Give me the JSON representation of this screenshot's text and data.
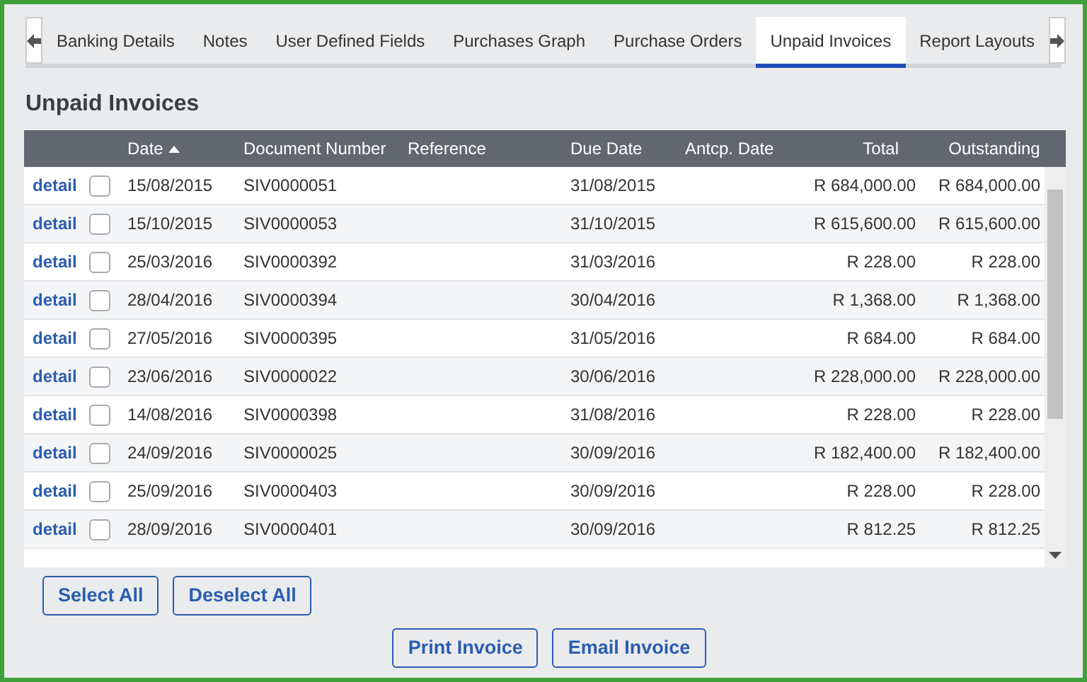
{
  "tabs": [
    {
      "label": "Banking Details",
      "selected": false
    },
    {
      "label": "Notes",
      "selected": false
    },
    {
      "label": "User Defined Fields",
      "selected": false
    },
    {
      "label": "Purchases Graph",
      "selected": false
    },
    {
      "label": "Purchase Orders",
      "selected": false
    },
    {
      "label": "Unpaid Invoices",
      "selected": true
    },
    {
      "label": "Report Layouts",
      "selected": false
    }
  ],
  "heading": "Unpaid Invoices",
  "table": {
    "columns": [
      {
        "label": "Date",
        "sorted": true
      },
      {
        "label": "Document Number",
        "sorted": false
      },
      {
        "label": "Reference",
        "sorted": false
      },
      {
        "label": "Due Date",
        "sorted": false
      },
      {
        "label": "Antcp. Date",
        "sorted": false
      },
      {
        "label": "Total",
        "sorted": false
      },
      {
        "label": "Outstanding",
        "sorted": false
      }
    ],
    "rows": [
      {
        "link": "detail",
        "checked": false,
        "date": "15/08/2015",
        "document_number": "SIV0000051",
        "due_date": "31/08/2015",
        "total": "R 684,000.00",
        "outstanding": "R 684,000.00"
      },
      {
        "link": "detail",
        "checked": false,
        "date": "15/10/2015",
        "document_number": "SIV0000053",
        "due_date": "31/10/2015",
        "total": "R 615,600.00",
        "outstanding": "R 615,600.00"
      },
      {
        "link": "detail",
        "checked": false,
        "date": "25/03/2016",
        "document_number": "SIV0000392",
        "due_date": "31/03/2016",
        "total": "R 228.00",
        "outstanding": "R 228.00"
      },
      {
        "link": "detail",
        "checked": false,
        "date": "28/04/2016",
        "document_number": "SIV0000394",
        "due_date": "30/04/2016",
        "total": "R 1,368.00",
        "outstanding": "R 1,368.00"
      },
      {
        "link": "detail",
        "checked": false,
        "date": "27/05/2016",
        "document_number": "SIV0000395",
        "due_date": "31/05/2016",
        "total": "R 684.00",
        "outstanding": "R 684.00"
      },
      {
        "link": "detail",
        "checked": false,
        "date": "23/06/2016",
        "document_number": "SIV0000022",
        "due_date": "30/06/2016",
        "total": "R 228,000.00",
        "outstanding": "R 228,000.00"
      },
      {
        "link": "detail",
        "checked": false,
        "date": "14/08/2016",
        "document_number": "SIV0000398",
        "due_date": "31/08/2016",
        "total": "R 228.00",
        "outstanding": "R 228.00"
      },
      {
        "link": "detail",
        "checked": false,
        "date": "24/09/2016",
        "document_number": "SIV0000025",
        "due_date": "30/09/2016",
        "total": "R 182,400.00",
        "outstanding": "R 182,400.00"
      },
      {
        "link": "detail",
        "checked": false,
        "date": "25/09/2016",
        "document_number": "SIV0000403",
        "due_date": "30/09/2016",
        "total": "R 228.00",
        "outstanding": "R 228.00"
      },
      {
        "link": "detail",
        "checked": false,
        "date": "28/09/2016",
        "document_number": "SIV0000401",
        "due_date": "30/09/2016",
        "total": "R 812.25",
        "outstanding": "R 812.25"
      }
    ]
  },
  "selection_buttons": [
    "Select All",
    "Deselect All"
  ],
  "action_buttons": [
    "Print Invoice",
    "Email Invoice"
  ]
}
